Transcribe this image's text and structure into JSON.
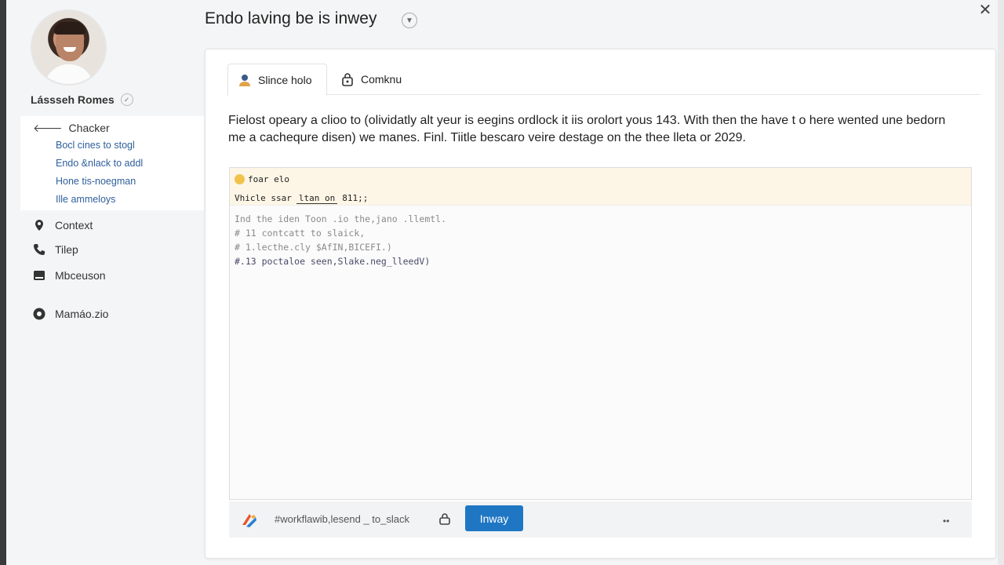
{
  "window": {
    "title": "Endo laving be is inwey"
  },
  "user": {
    "name": "Lássseh Romes"
  },
  "sidebar": {
    "group": {
      "label": "Chacker",
      "items": [
        "Bocl cines to stogl",
        "Endo &nlack to addl",
        "Hone tis-noegman",
        "Ille ammeloys"
      ]
    },
    "nav": [
      {
        "label": "Context",
        "icon": "pin-icon"
      },
      {
        "label": "Tilep",
        "icon": "phone-icon"
      },
      {
        "label": "Mbceuson",
        "icon": "keyboard-icon"
      },
      {
        "label": "Mamáo.zio",
        "icon": "help-circle-icon"
      }
    ]
  },
  "tabs": [
    {
      "label": "Slince holo",
      "icon": "person-icon",
      "active": true
    },
    {
      "label": "Comknu",
      "icon": "lock-icon",
      "active": false
    }
  ],
  "description": "Fielost opeary a clioo to (olividatly alt yeur is eegins ordlock it iis orolort yous 143. With then the have t o here wented une bedorn me a cachequre disen) we manes. Finl. Tiitle bescaro veire destage on the thee lleta or 2029.",
  "editor": {
    "header_title": "foar elo",
    "header_line_prefix": "Vhicle ssar",
    "header_line_underlined": "ltan on",
    "header_line_suffix": "811;;",
    "lines": [
      "Ind the iden Toon .io the,jano .llemtl.",
      "# 11  contcatt to slaick,",
      "# 1.lecthe.cly $AfIN,BICEFI.)",
      "#.13 poctaloe seen,Slake.neg_lleedV)"
    ]
  },
  "footer": {
    "workflow_text": "#workflawib,lesend _ to_slack",
    "primary_button": "Inway",
    "more": "••"
  },
  "colors": {
    "primary": "#1f77c4",
    "link": "#2f5f9c",
    "editor_header_bg": "#fdf6e6"
  }
}
